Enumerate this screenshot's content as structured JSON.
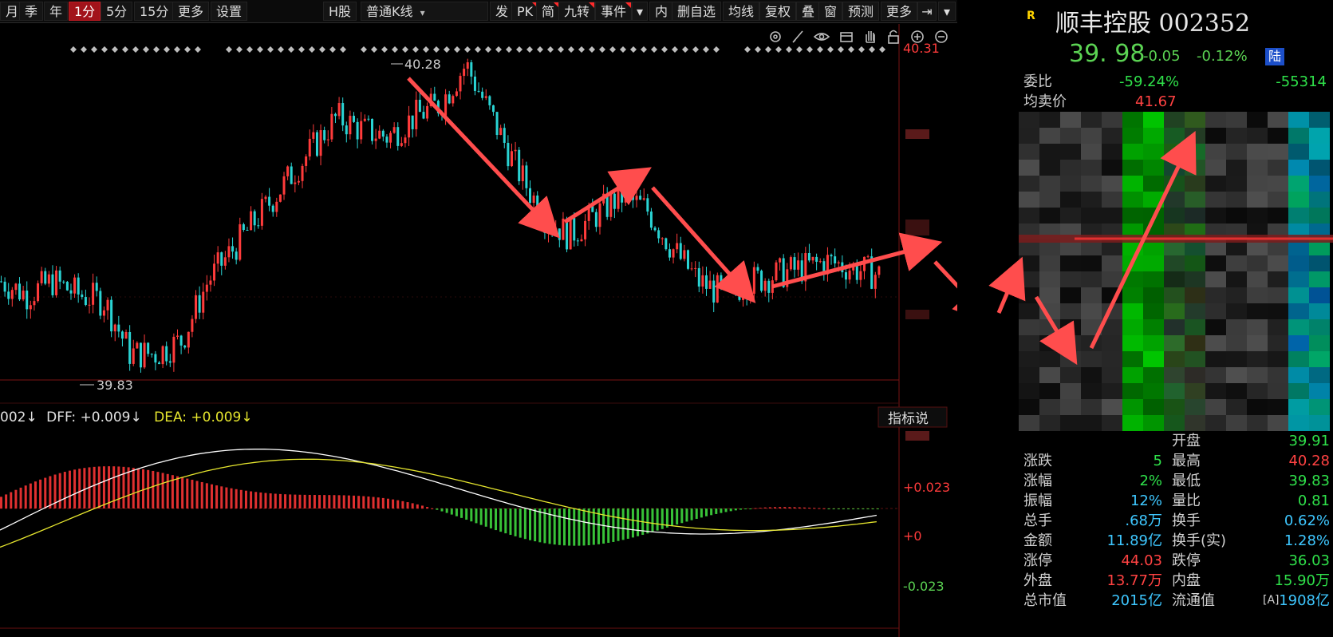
{
  "toolbar": {
    "items": [
      "月",
      "季",
      "年",
      "1分",
      "5分",
      "15分",
      "更多",
      "设置",
      "H股",
      "普通K线",
      "发",
      "PK",
      "简",
      "九转",
      "事件",
      "内",
      "删自选",
      "均线",
      "复权",
      "叠",
      "窗",
      "预测",
      "更多"
    ],
    "active": "1分"
  },
  "chart": {
    "price_high_axis": "40.31",
    "high_marker": "40.28",
    "low_marker": "39.83",
    "macd_header": {
      "prefix": "002↓",
      "diff": "DFF: +0.009↓",
      "dea": "DEA: +0.009↓"
    },
    "macd_axis": [
      "+0.023",
      "+0",
      "-0.023"
    ],
    "indicator_button": "指标说"
  },
  "chart_data": {
    "type": "candlestick",
    "ylim": [
      39.8,
      40.31
    ],
    "high": 40.28,
    "low": 39.83,
    "trend_close": [
      39.95,
      39.93,
      39.95,
      39.93,
      39.92,
      39.84,
      39.84,
      39.86,
      39.95,
      40.0,
      40.05,
      40.1,
      40.15,
      40.2,
      40.18,
      40.17,
      40.2,
      40.22,
      40.28,
      40.2,
      40.12,
      40.05,
      40.02,
      40.05,
      40.08,
      40.06,
      40.0,
      39.95,
      39.93,
      39.95,
      39.96,
      39.97,
      39.98,
      39.97,
      39.96
    ]
  },
  "quote": {
    "badge": "R",
    "title": "顺丰控股 002352",
    "price": "39. 98",
    "change": "-0.05",
    "change_pct": "-0.12%",
    "market_badge": "陆",
    "weibi_label": "委比",
    "weibi_pct": "-59.24%",
    "weibi_diff": "-55314",
    "avg_sell_label": "均卖价",
    "avg_sell_value": "41.67",
    "stats": [
      {
        "l1": "",
        "v1": "",
        "l2": "开盘",
        "v2": "39.91"
      },
      {
        "l1": "涨跌",
        "v1": "5",
        "l2": "最高",
        "v2": "40.28"
      },
      {
        "l1": "涨幅",
        "v1": "2%",
        "l2": "最低",
        "v2": "39.83"
      },
      {
        "l1": "振幅",
        "v1": "12%",
        "l2": "量比",
        "v2": "0.81"
      },
      {
        "l1": "总手",
        "v1": ".68万",
        "l2": "换手",
        "v2": "0.62%"
      },
      {
        "l1": "金额",
        "v1": "11.89亿",
        "l2": "换手(实)",
        "v2": "1.28%"
      },
      {
        "l1": "涨停",
        "v1": "44.03",
        "l2": "跌停",
        "v2": "36.03"
      },
      {
        "l1": "外盘",
        "v1": "13.77万",
        "l2": "内盘",
        "v2": "15.90万"
      },
      {
        "l1": "总市值",
        "v1": "2015亿",
        "l2": "流通值",
        "v2": "1908亿"
      }
    ],
    "flow_label": "[A]"
  },
  "colors": {
    "up": "#ff3b3b",
    "down": "#2ad4d4",
    "arrow": "#ff4d4d",
    "dif": "#ffffff",
    "dea": "#e6e62e",
    "hist_up": "#e03030",
    "hist_down": "#38c238"
  },
  "icons": [
    "gear-icon",
    "pen-icon",
    "eye-icon",
    "box-icon",
    "hand-icon",
    "lock-icon",
    "zoom-in-icon",
    "zoom-out-icon"
  ]
}
